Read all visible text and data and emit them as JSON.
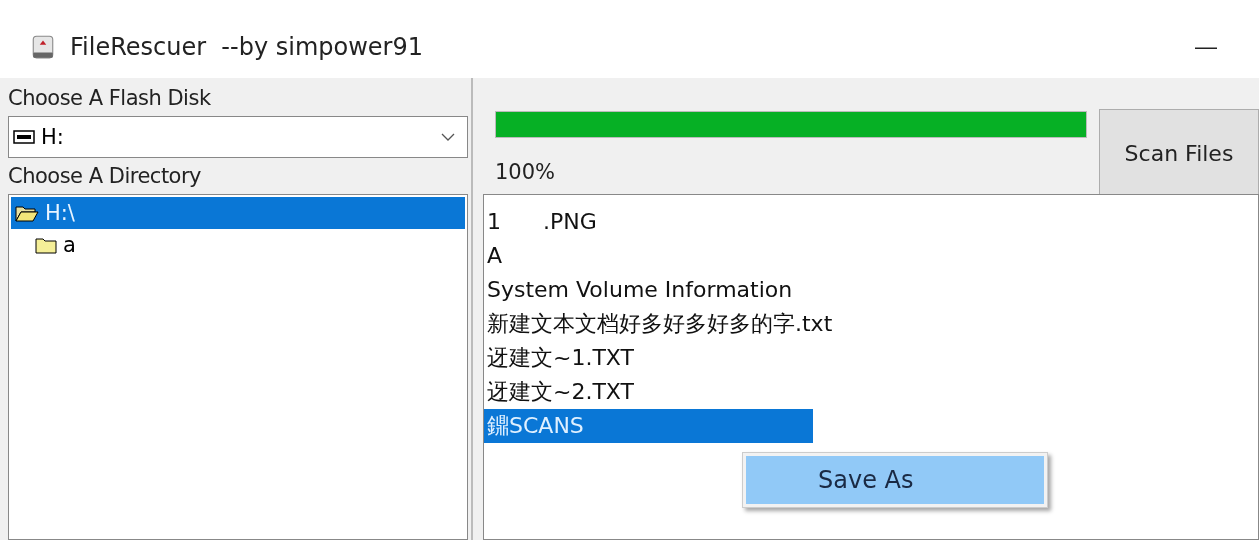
{
  "window": {
    "title": "FileRescuer  --by simpower91",
    "minimize": "—"
  },
  "disk": {
    "label": "Choose A Flash Disk",
    "value": "H:"
  },
  "directory": {
    "label": "Choose A Directory",
    "tree": [
      {
        "label": "H:\\",
        "selected": true,
        "expanded": true,
        "children": [
          {
            "label": "a",
            "selected": false,
            "expanded": false
          }
        ]
      }
    ]
  },
  "progress": {
    "level": 1.0,
    "reading": "100%"
  },
  "scan_button": "Scan Files",
  "files": [
    {
      "name": "1      .PNG",
      "selected": false
    },
    {
      "name": "A",
      "selected": false
    },
    {
      "name": "System Volume Information",
      "selected": false
    },
    {
      "name": "新建文本文档好多好多好多的字.txt",
      "selected": false
    },
    {
      "name": "迓建文~1.TXT",
      "selected": false
    },
    {
      "name": "迓建文~2.TXT",
      "selected": false
    },
    {
      "name": "鐤SCANS",
      "selected": true
    }
  ],
  "context_menu": [
    {
      "label": "Save As",
      "selected": true
    }
  ]
}
